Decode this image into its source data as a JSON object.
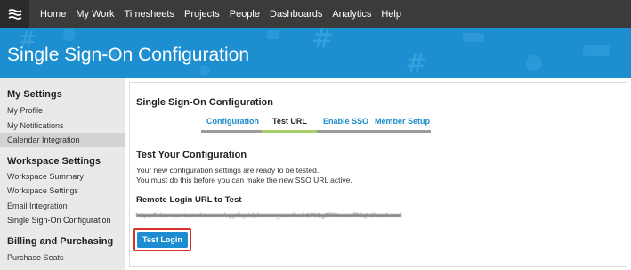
{
  "nav": {
    "logo_icon": "app-logo-icon",
    "items": [
      "Home",
      "My Work",
      "Timesheets",
      "Projects",
      "People",
      "Dashboards",
      "Analytics",
      "Help"
    ]
  },
  "banner": {
    "title": "Single Sign-On Configuration"
  },
  "sidebar": {
    "sections": [
      {
        "heading": "My Settings",
        "items": [
          "My Profile",
          "My Notifications",
          "Calendar Integration"
        ]
      },
      {
        "heading": "Workspace Settings",
        "items": [
          "Workspace Summary",
          "Workspace Settings",
          "Email Integration",
          "Single Sign-On Configuration"
        ]
      },
      {
        "heading": "Billing and Purchasing",
        "items": [
          "Purchase Seats"
        ]
      }
    ],
    "active_item": "Single Sign-On Configuration"
  },
  "main": {
    "title": "Single Sign-On Configuration",
    "tabs": [
      {
        "label": "Configuration",
        "active": false
      },
      {
        "label": "Test URL",
        "active": true
      },
      {
        "label": "Enable SSO",
        "active": false
      },
      {
        "label": "Member Setup",
        "active": false
      }
    ],
    "test_heading": "Test Your Configuration",
    "body_lines": [
      "Your new configuration settings are ready to be tested.",
      "You must do this before you can make the new SSO URL active."
    ],
    "url_label": "Remote Login URL to Test",
    "url_value": "https://okta-sso-test.okta.com/app/liquidplanner_saml/exk1719g8f76mwwf7dq1d/sso/saml",
    "test_button": "Test Login"
  },
  "colors": {
    "nav_bg": "#3b3b3b",
    "banner_bg": "#1d8fd1",
    "link": "#1a8bc9",
    "active_tab_underline": "#a7d06a",
    "button_bg": "#1c8dd0",
    "highlight_border": "#d9322a"
  }
}
